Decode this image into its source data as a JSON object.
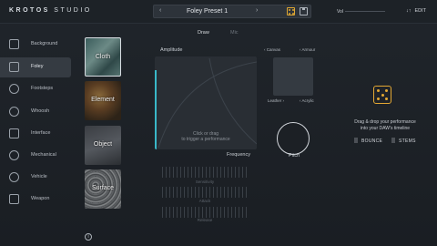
{
  "brand": {
    "left": "KROTOS",
    "right": "STUDIO"
  },
  "preset": {
    "name": "Foley Preset 1",
    "prev": "‹",
    "next": "›"
  },
  "header": {
    "vol_label": "Vol",
    "edit_label": "EDIT",
    "edit_icon": "↓↑"
  },
  "sidebar": {
    "items": [
      {
        "label": "Background",
        "icon": "mountain-icon"
      },
      {
        "label": "Foley",
        "icon": "foley-icon"
      },
      {
        "label": "Footsteps",
        "icon": "footsteps-icon"
      },
      {
        "label": "Whoosh",
        "icon": "whoosh-icon"
      },
      {
        "label": "Interface",
        "icon": "interface-icon"
      },
      {
        "label": "Mechanical",
        "icon": "gear-icon"
      },
      {
        "label": "Vehicle",
        "icon": "car-icon"
      },
      {
        "label": "Weapon",
        "icon": "gun-icon"
      }
    ]
  },
  "tiles": [
    {
      "label": "Cloth"
    },
    {
      "label": "Element"
    },
    {
      "label": "Object"
    },
    {
      "label": "Surface"
    }
  ],
  "tabs": {
    "draw": "Draw",
    "mic": "Mic"
  },
  "pad": {
    "amplitude_label": "Amplitude",
    "hint_line1": "Click or drag",
    "hint_line2": "to trigger a performance",
    "frequency_label": "Frequency",
    "accent": "#39b8c8"
  },
  "morph": {
    "top_left": "‹ Canvas",
    "top_right": "‹ Armour",
    "bottom_left": "Leather ›",
    "bottom_right": "‹ Acrylic"
  },
  "knob": {
    "label": "Pitch"
  },
  "sliders": {
    "sensitivity": "Sensitivity",
    "attack": "Attack",
    "release": "Release"
  },
  "export": {
    "text_line1": "Drag & drop your performance",
    "text_line2": "into your DAW's timeline",
    "bounce": "BOUNCE",
    "stems": "STEMS",
    "accent": "#e3a733"
  },
  "info": {
    "symbol": "i"
  }
}
